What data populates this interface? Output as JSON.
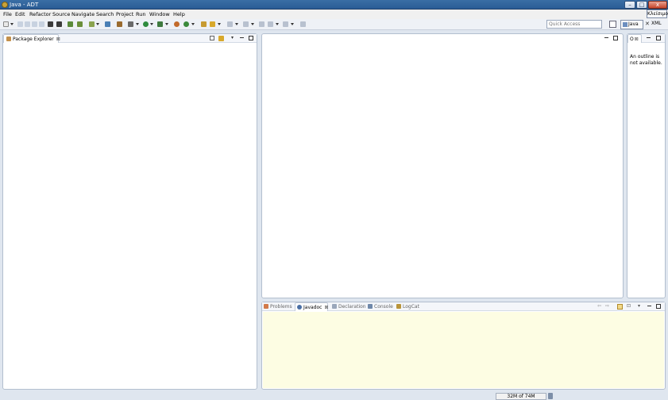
{
  "window": {
    "title": "Java - ADT",
    "lang_button": "Κλείσιμο",
    "controls": {
      "minimize": "–",
      "maximize": "□",
      "close": "x"
    }
  },
  "menu": [
    "File",
    "Edit",
    "Refactor",
    "Source",
    "Navigate",
    "Search",
    "Project",
    "Run",
    "Window",
    "Help"
  ],
  "toolbar": {
    "quick_access_placeholder": "Quick Access",
    "perspectives": {
      "java": "Java",
      "xml": "XML"
    }
  },
  "package_explorer": {
    "tab_label": "Package Explorer",
    "close": "⊠"
  },
  "outline": {
    "tab_label": "O",
    "close": "⊠",
    "message": "An outline is not available."
  },
  "bottom_panel": {
    "tabs": [
      {
        "label": "Problems",
        "active": false
      },
      {
        "label": "Javadoc",
        "active": true,
        "close": "⊠"
      },
      {
        "label": "Declaration",
        "active": false
      },
      {
        "label": "Console",
        "active": false
      },
      {
        "label": "LogCat",
        "active": false
      }
    ]
  },
  "status": {
    "heap": "32M of 74M"
  },
  "colors": {
    "titlebar": "#3a6ea5",
    "panel_border": "#b3bfcf",
    "javadoc_bg": "#fdfde3",
    "workbench_bg": "#dfe6ef"
  }
}
